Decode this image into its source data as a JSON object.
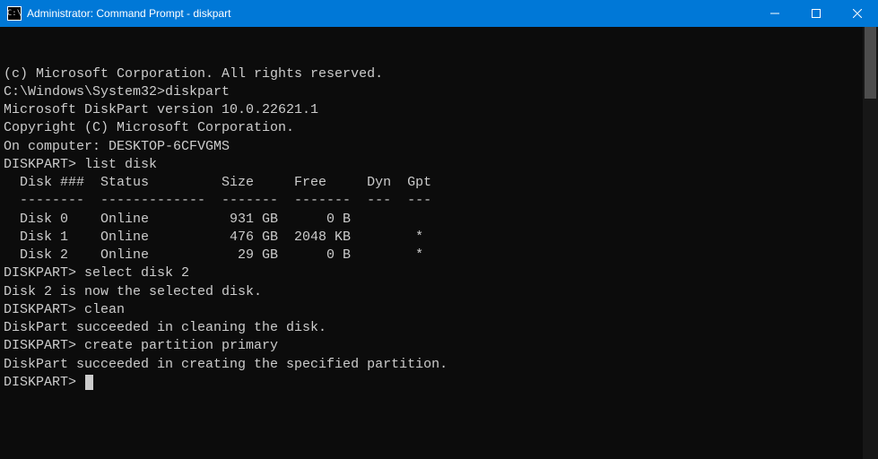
{
  "titlebar": {
    "icon_label": "C:\\",
    "title": "Administrator: Command Prompt - diskpart"
  },
  "colors": {
    "titlebar_bg": "#0078d7",
    "terminal_bg": "#0c0c0c",
    "terminal_fg": "#cccccc"
  },
  "terminal": {
    "lines": [
      "(c) Microsoft Corporation. All rights reserved.",
      "",
      "C:\\Windows\\System32>diskpart",
      "",
      "Microsoft DiskPart version 10.0.22621.1",
      "",
      "Copyright (C) Microsoft Corporation.",
      "On computer: DESKTOP-6CFVGMS",
      "",
      "DISKPART> list disk",
      "",
      "  Disk ###  Status         Size     Free     Dyn  Gpt",
      "  --------  -------------  -------  -------  ---  ---",
      "  Disk 0    Online          931 GB      0 B",
      "  Disk 1    Online          476 GB  2048 KB        *",
      "  Disk 2    Online           29 GB      0 B        *",
      "",
      "DISKPART> select disk 2",
      "",
      "Disk 2 is now the selected disk.",
      "",
      "DISKPART> clean",
      "",
      "DiskPart succeeded in cleaning the disk.",
      "",
      "DISKPART> create partition primary",
      "",
      "DiskPart succeeded in creating the specified partition.",
      "",
      "DISKPART>"
    ],
    "disks": [
      {
        "id": "Disk 0",
        "status": "Online",
        "size": "931 GB",
        "free": "0 B",
        "dyn": "",
        "gpt": ""
      },
      {
        "id": "Disk 1",
        "status": "Online",
        "size": "476 GB",
        "free": "2048 KB",
        "dyn": "",
        "gpt": "*"
      },
      {
        "id": "Disk 2",
        "status": "Online",
        "size": "29 GB",
        "free": "0 B",
        "dyn": "",
        "gpt": "*"
      }
    ],
    "prompt": "DISKPART>"
  }
}
